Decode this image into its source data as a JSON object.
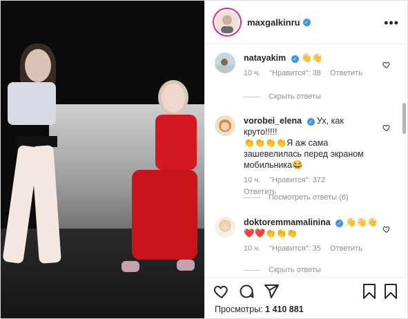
{
  "post": {
    "author": "maxgalkinru",
    "views_label": "Просмотры:",
    "views_value": "1 410 881"
  },
  "comments": [
    {
      "user": "natayakim",
      "text": "",
      "emoji": "👋👋",
      "time": "10 ч.",
      "likes": "\"Нравится\": 38",
      "reply": "Ответить",
      "replies": "Скрыть ответы"
    },
    {
      "user": "vorobei_elena",
      "text": "Ух, как круто!!!!!",
      "text2": "👏👏👏👏Я аж сама",
      "text3": "зашевелилась перед экраном",
      "text4": "мобильника😂",
      "time": "10 ч.",
      "likes": "\"Нравится\": 372",
      "reply": "Ответить",
      "replies": "Посмотреть ответы (6)"
    },
    {
      "user": "doktoremmamalinina",
      "emoji": "👋👋👋",
      "text2": "❤️❤️👏👏👏",
      "time": "10 ч.",
      "likes": "\"Нравится\": 35",
      "reply": "Ответить",
      "replies": "Скрыть ответы"
    }
  ],
  "icons": [
    "heart-icon",
    "comment-icon",
    "share-icon",
    "bookmark-icon",
    "more-icon",
    "verified-icon"
  ]
}
